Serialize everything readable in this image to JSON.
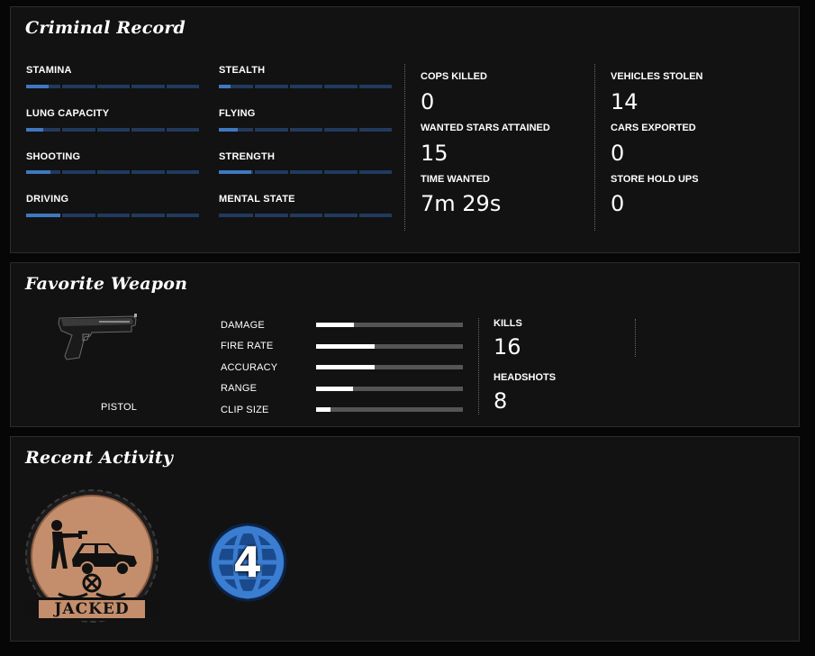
{
  "criminal_record": {
    "title": "Criminal Record",
    "skills_left": [
      {
        "label": "STAMINA",
        "level": 0.13
      },
      {
        "label": "LUNG CAPACITY",
        "level": 0.1
      },
      {
        "label": "SHOOTING",
        "level": 0.14
      },
      {
        "label": "DRIVING",
        "level": 0.2
      }
    ],
    "skills_right": [
      {
        "label": "STEALTH",
        "level": 0.07
      },
      {
        "label": "FLYING",
        "level": 0.11
      },
      {
        "label": "STRENGTH",
        "level": 0.19
      },
      {
        "label": "MENTAL STATE",
        "level": 0.0
      }
    ],
    "stats_col1": [
      {
        "label": "COPS KILLED",
        "value": "0"
      },
      {
        "label": "WANTED STARS ATTAINED",
        "value": "15"
      },
      {
        "label": "TIME WANTED",
        "value": "7m 29s"
      }
    ],
    "stats_col2": [
      {
        "label": "VEHICLES STOLEN",
        "value": "14"
      },
      {
        "label": "CARS EXPORTED",
        "value": "0"
      },
      {
        "label": "STORE HOLD UPS",
        "value": "0"
      }
    ]
  },
  "favorite_weapon": {
    "title": "Favorite Weapon",
    "name": "PISTOL",
    "icon": "pistol-icon",
    "stats": [
      {
        "label": "DAMAGE",
        "level": 0.26
      },
      {
        "label": "FIRE RATE",
        "level": 0.4
      },
      {
        "label": "ACCURACY",
        "level": 0.4
      },
      {
        "label": "RANGE",
        "level": 0.25
      },
      {
        "label": "CLIP SIZE",
        "level": 0.1
      }
    ],
    "kills_label": "KILLS",
    "kills_value": "16",
    "headshots_label": "HEADSHOTS",
    "headshots_value": "8"
  },
  "recent_activity": {
    "title": "Recent Activity",
    "badge1_text": "JACKED",
    "badge1_icon": "carjacking-badge-icon",
    "badge2_text": "4",
    "badge2_icon": "globe-rank-icon"
  }
}
